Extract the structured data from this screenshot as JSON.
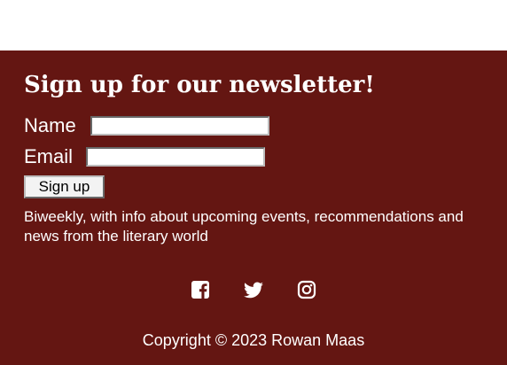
{
  "newsletter": {
    "title": "Sign up for our newsletter!",
    "name_label": "Name",
    "name_value": "",
    "email_label": "Email",
    "email_value": "",
    "submit_label": "Sign up",
    "description": "Biweekly, with info about upcoming events, recommendations and news from the literary world"
  },
  "social": {
    "items": [
      {
        "icon": "facebook-icon"
      },
      {
        "icon": "twitter-icon"
      },
      {
        "icon": "instagram-icon"
      }
    ]
  },
  "footer": {
    "copyright": "Copyright © 2023 Rowan Maas"
  },
  "colors": {
    "footer_background": "#641612",
    "text": "#ffffff",
    "top_background": "#ffffff"
  }
}
